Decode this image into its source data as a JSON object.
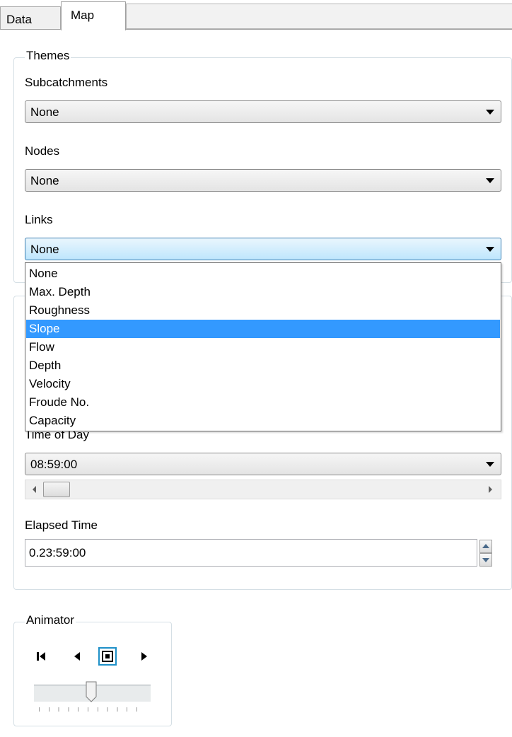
{
  "tabs": [
    {
      "label": "Data",
      "active": false
    },
    {
      "label": "Map",
      "active": true
    }
  ],
  "themes": {
    "legend": "Themes",
    "subcatchments": {
      "label": "Subcatchments",
      "value": "None"
    },
    "nodes": {
      "label": "Nodes",
      "value": "None"
    },
    "links": {
      "label": "Links",
      "value": "None",
      "open": true,
      "options": [
        "None",
        "Max. Depth",
        "Roughness",
        "Slope",
        "Flow",
        "Depth",
        "Velocity",
        "Froude No.",
        "Capacity"
      ],
      "highlighted": "Slope"
    }
  },
  "time": {
    "time_of_day_label": "Time of Day",
    "time_of_day_value": "08:59:00",
    "elapsed_label": "Elapsed Time",
    "elapsed_value": "0.23:59:00"
  },
  "animator": {
    "legend": "Animator",
    "buttons": [
      "rewind",
      "back",
      "stop",
      "forward"
    ]
  },
  "colors": {
    "selection": "#3399ff",
    "active_combo": "#bee6fd",
    "group_border": "#d5dfe5"
  }
}
